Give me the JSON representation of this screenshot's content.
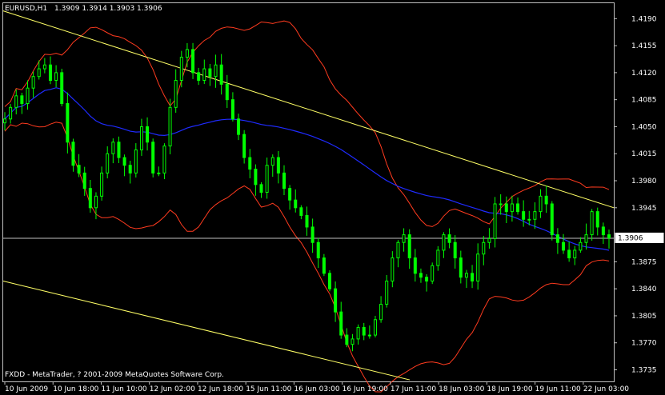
{
  "header": {
    "symbol_tf": "EURUSD,H1",
    "ohlc": "1.3909 1.3914 1.3903 1.3906"
  },
  "footer": {
    "copyright": "FXDD - MetaTrader, ? 2001-2009 MetaQuotes Software Corp."
  },
  "current_price": {
    "label": "1.3906",
    "value": 1.3906
  },
  "colors": {
    "background": "#000000",
    "candle": "#00ff00",
    "bollinger": "#ff3b1f",
    "moving_average": "#1f2bff",
    "trendline": "#ffff66",
    "price_line": "#c0c0c0",
    "axis": "#c0c0c0",
    "text": "#ffffff"
  },
  "chart_data": {
    "type": "candlestick",
    "symbol": "EURUSD",
    "timeframe": "H1",
    "ylim": [
      1.372,
      1.421
    ],
    "y_ticks": [
      "1.4190",
      "1.4155",
      "1.4120",
      "1.4085",
      "1.4050",
      "1.4015",
      "1.3980",
      "1.3945",
      "1.3875",
      "1.3840",
      "1.3805",
      "1.3770",
      "1.3735"
    ],
    "x_ticks": [
      "10 Jun 2009",
      "10 Jun 18:00",
      "11 Jun 10:00",
      "12 Jun 02:00",
      "12 Jun 18:00",
      "15 Jun 11:00",
      "16 Jun 03:00",
      "16 Jun 19:00",
      "17 Jun 11:00",
      "18 Jun 03:00",
      "18 Jun 19:00",
      "19 Jun 11:00",
      "22 Jun 03:00"
    ],
    "series": [
      {
        "kind": "price",
        "close": [
          1.406,
          1.4075,
          1.409,
          1.408,
          1.41,
          1.4115,
          1.4125,
          1.413,
          1.411,
          1.412,
          1.408,
          1.403,
          1.4,
          1.399,
          1.397,
          1.3945,
          1.396,
          1.399,
          1.4015,
          1.403,
          1.401,
          1.4,
          1.399,
          1.402,
          1.405,
          1.403,
          1.399,
          1.399,
          1.4025,
          1.4075,
          1.411,
          1.414,
          1.415,
          1.412,
          1.411,
          1.4125,
          1.4115,
          1.413,
          1.4105,
          1.4085,
          1.406,
          1.404,
          1.401,
          1.3995,
          1.3975,
          1.3965,
          1.4,
          1.401,
          1.399,
          1.397,
          1.3955,
          1.3945,
          1.3935,
          1.392,
          1.39,
          1.388,
          1.386,
          1.384,
          1.381,
          1.378,
          1.3768,
          1.3775,
          1.379,
          1.378,
          1.378,
          1.38,
          1.382,
          1.385,
          1.388,
          1.39,
          1.391,
          1.388,
          1.386,
          1.3855,
          1.385,
          1.387,
          1.389,
          1.391,
          1.39,
          1.388,
          1.3855,
          1.386,
          1.385,
          1.3885,
          1.39,
          1.3905,
          1.395,
          1.395,
          1.394,
          1.395,
          1.394,
          1.393,
          1.393,
          1.394,
          1.396,
          1.395,
          1.391,
          1.39,
          1.389,
          1.388,
          1.389,
          1.39,
          1.391,
          1.394,
          1.392,
          1.391,
          1.3906
        ]
      }
    ]
  }
}
